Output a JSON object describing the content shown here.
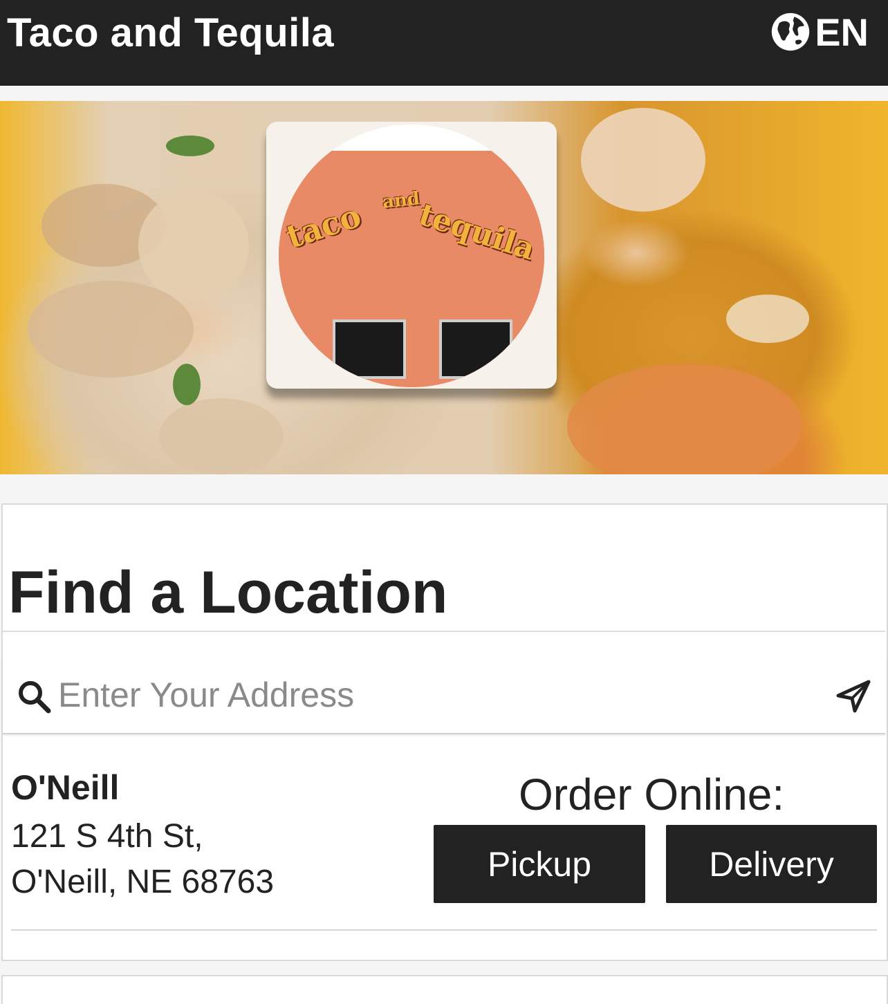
{
  "header": {
    "brand": "Taco and Tequila",
    "language": "EN",
    "background": "#222222"
  },
  "hero": {
    "logo": {
      "word_left": "taco",
      "word_and": "and",
      "word_right": "tequila"
    }
  },
  "finder": {
    "title": "Find a Location",
    "search": {
      "placeholder": "Enter Your Address",
      "value": ""
    }
  },
  "locations": [
    {
      "name": "O'Neill",
      "address_line1": "121 S 4th St,",
      "address_line2": "O'Neill, NE 68763",
      "order_label": "Order Online:",
      "pickup_label": "Pickup",
      "delivery_label": "Delivery"
    }
  ],
  "colors": {
    "button": "#222222",
    "button_text": "#ffffff"
  },
  "icons": {
    "language": "globe-icon",
    "search": "search-icon",
    "locate": "location-arrow-icon"
  }
}
